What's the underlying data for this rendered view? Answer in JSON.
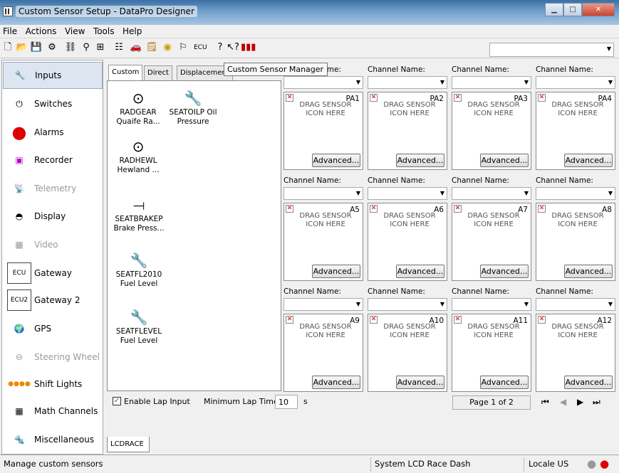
{
  "window": {
    "title": "Custom Sensor Setup - DataPro Designer"
  },
  "menu": [
    "File",
    "Actions",
    "View",
    "Tools",
    "Help"
  ],
  "tooltip": "Custom Sensor Manager",
  "sidebar": {
    "items": [
      {
        "label": "Inputs",
        "icon": "inputs-sensor-icon",
        "selected": true,
        "disabled": false
      },
      {
        "label": "Switches",
        "icon": "switch-icon",
        "selected": false,
        "disabled": false
      },
      {
        "label": "Alarms",
        "icon": "alarm-icon",
        "selected": false,
        "disabled": false
      },
      {
        "label": "Recorder",
        "icon": "recorder-icon",
        "selected": false,
        "disabled": false
      },
      {
        "label": "Telemetry",
        "icon": "telemetry-icon",
        "selected": false,
        "disabled": true
      },
      {
        "label": "Display",
        "icon": "display-icon",
        "selected": false,
        "disabled": false
      },
      {
        "label": "Video",
        "icon": "video-icon",
        "selected": false,
        "disabled": true
      },
      {
        "label": "Gateway",
        "icon": "ecu-icon",
        "selected": false,
        "disabled": false
      },
      {
        "label": "Gateway 2",
        "icon": "ecu2-icon",
        "selected": false,
        "disabled": false
      },
      {
        "label": "GPS",
        "icon": "globe-icon",
        "selected": false,
        "disabled": false
      },
      {
        "label": "Steering Wheel",
        "icon": "steering-wheel-icon",
        "selected": false,
        "disabled": true
      },
      {
        "label": "Shift Lights",
        "icon": "shift-lights-icon",
        "selected": false,
        "disabled": false
      },
      {
        "label": "Math Channels",
        "icon": "calculator-icon",
        "selected": false,
        "disabled": false
      },
      {
        "label": "Miscellaneous",
        "icon": "tools-icon",
        "selected": false,
        "disabled": false
      }
    ]
  },
  "sensor_tabs": [
    "Custom",
    "Direct",
    "Displacement"
  ],
  "sensors": [
    {
      "name": "RADGEAR",
      "desc": "Quaife Ra...",
      "icon": "locator-icon"
    },
    {
      "name": "SEATOILP",
      "desc": "Oil Pressure",
      "icon": "pressure-sensor-icon"
    },
    {
      "name": "RADHEWL",
      "desc": "Hewland ...",
      "icon": "locator-icon"
    },
    {
      "name": "SEATBRAKEP",
      "desc": "Brake Press...",
      "icon": "brake-sensor-icon"
    },
    {
      "name": "SEATFL2010",
      "desc": "Fuel Level",
      "icon": "pressure-sensor-icon"
    },
    {
      "name": "SEATFLEVEL",
      "desc": "Fuel Level",
      "icon": "pressure-sensor-icon"
    }
  ],
  "channel_label": "Channel Name:",
  "drag_text": "DRAG SENSOR ICON HERE",
  "advanced_label": "Advanced...",
  "channels": [
    "PA1",
    "PA2",
    "PA3",
    "PA4",
    "A5",
    "A6",
    "A7",
    "A8",
    "A9",
    "A10",
    "A11",
    "A12"
  ],
  "lap": {
    "enable_label": "Enable Lap Input",
    "checked": true,
    "min_label": "Minimum Lap Time:",
    "min_value": "10",
    "unit": "s"
  },
  "pager": {
    "text": "Page 1 of 2"
  },
  "bottom_tab": "LCDRACE",
  "status": {
    "message": "Manage custom sensors",
    "system": "System  LCD Race Dash",
    "locale": "Locale  US"
  }
}
